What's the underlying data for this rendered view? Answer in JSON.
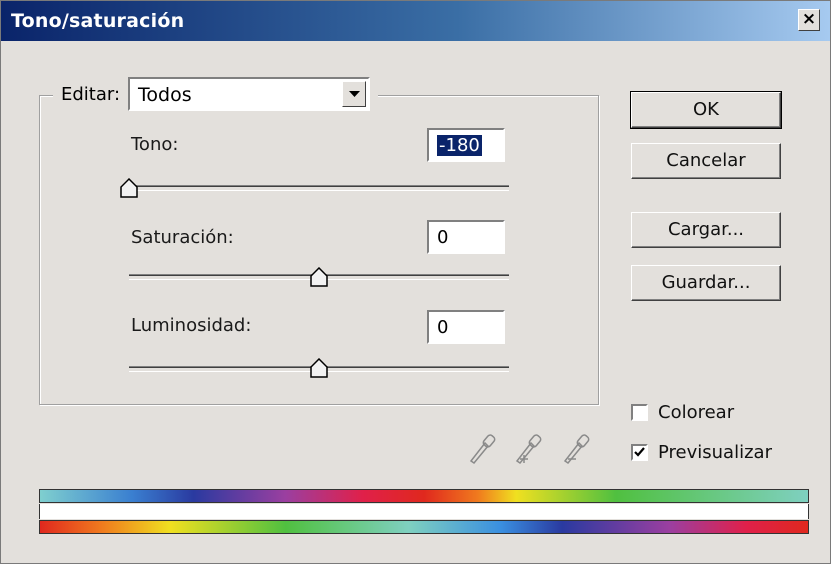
{
  "window": {
    "title": "Tono/saturación",
    "close_label": "×"
  },
  "edit": {
    "label": "Editar:",
    "selected": "Todos"
  },
  "sliders": [
    {
      "label": "Tono:",
      "value": "-180",
      "value_fraction": 0.0
    },
    {
      "label": "Saturación:",
      "value": "0",
      "value_fraction": 0.5
    },
    {
      "label": "Luminosidad:",
      "value": "0",
      "value_fraction": 0.5
    }
  ],
  "buttons": {
    "ok": "OK",
    "cancel": "Cancelar",
    "load": "Cargar...",
    "save": "Guardar..."
  },
  "options": {
    "colorize": {
      "label": "Colorear",
      "checked": false
    },
    "preview": {
      "label": "Previsualizar",
      "checked": true
    }
  },
  "icons": {
    "eyedropper": "eyedropper-icon",
    "eyedropper_add": "eyedropper-plus-icon",
    "eyedropper_subtract": "eyedropper-minus-icon",
    "dropdown": "chevron-down-icon",
    "close": "close-icon",
    "check": "check-icon"
  }
}
